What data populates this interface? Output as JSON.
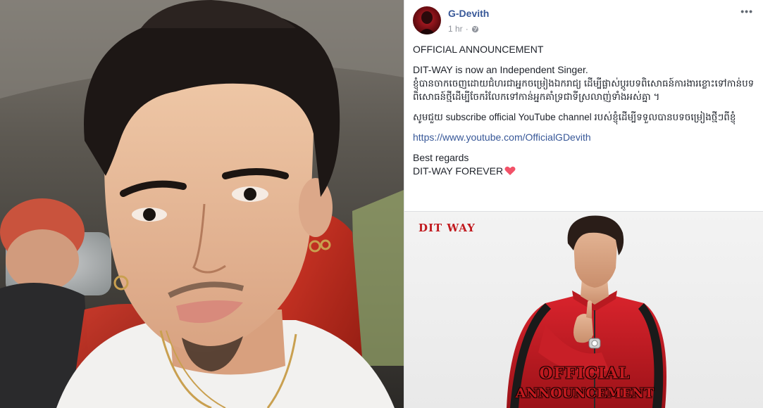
{
  "post": {
    "author": "G-Devith",
    "time": "1 hr",
    "privacy_icon": "globe-icon",
    "more_icon": "more-options-icon",
    "announcement_title": "OFFICIAL ANNOUNCEMENT",
    "line_independent": "DIT-WAY is now an Independent Singer.",
    "khmer_paragraph": "ខ្ញុំបានចាកចេញដោយជំហរជាអ្នកចម្រៀងឯករាជ្យ ដើម្បីផ្លាស់ប្តូរបទពិសោធន៍ការងារខ្លោះទៅកាន់បទពិសោធន៍ថ្មីដើម្បីចែករំលែកទៅកាន់អ្នកគាំទ្រជាទីស្រលាញ់ទាំងអស់គ្នា ។",
    "subscribe_paragraph": "សូមជួយ subscribe official YouTube channel របស់ខ្ញុំដើម្បីទទួលបានបទចម្រៀងថ្មីៗពីខ្ញុំ",
    "youtube_link": "https://www.youtube.com/OfficialGDevith",
    "regards": "Best regards",
    "sign_off": "DIT-WAY FOREVER",
    "heart_icon": "heart-icon"
  },
  "promo": {
    "logo_text": "DIT WAY",
    "title_line1": "OFFICIAL",
    "title_line2": "ANNOUNCEMENT"
  },
  "colors": {
    "facebook_link": "#385898",
    "meta_gray": "#90949c",
    "text": "#1d2129",
    "heart": "#f25268",
    "promo_red": "#c11a1f"
  }
}
